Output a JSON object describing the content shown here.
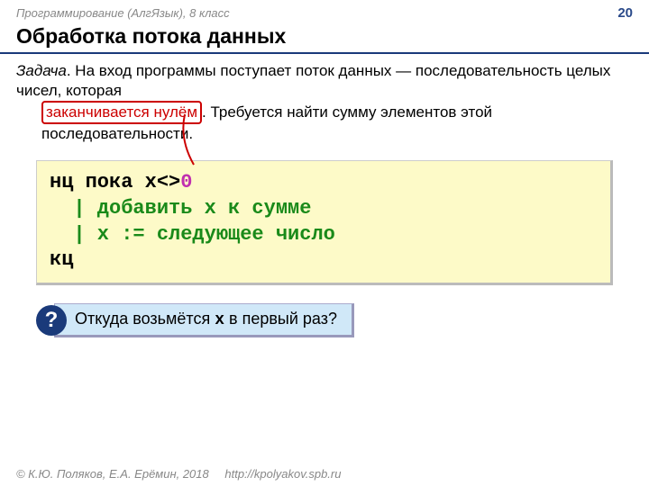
{
  "header": {
    "course": "Программирование (АлгЯзык), 8 класс",
    "page": "20"
  },
  "title": "Обработка потока данных",
  "task": {
    "label": "Задача",
    "before": ". На вход программы поступает поток данных — последовательность целых чисел, которая ",
    "highlight": "заканчивается нулём",
    "after": ". Требуется найти сумму элементов этой последовательности."
  },
  "code": {
    "l1a": "нц пока x",
    "l1b": "<>",
    "l1c": "0",
    "l2": "  | добавить x к сумме",
    "l3": "  | x := следующее число",
    "l4": "кц"
  },
  "question": {
    "mark": "?",
    "t1": " Откуда возьмётся ",
    "tvar": "x",
    "t2": "  в первый раз?"
  },
  "footer": {
    "copyright": "© К.Ю. Поляков, Е.А. Ерёмин, 2018",
    "url": "http://kpolyakov.spb.ru"
  }
}
